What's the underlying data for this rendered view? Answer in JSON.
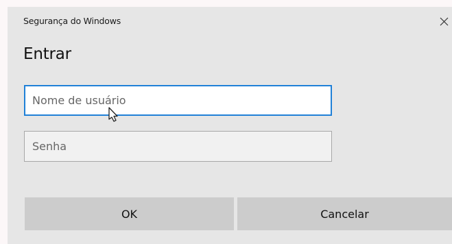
{
  "dialog": {
    "window_title": "Segurança do Windows",
    "heading": "Entrar",
    "close_glyph": "✕",
    "username": {
      "value": "",
      "placeholder": "Nome de usuário"
    },
    "password": {
      "value": "",
      "placeholder": "Senha"
    },
    "buttons": {
      "ok_label": "OK",
      "cancel_label": "Cancelar"
    }
  },
  "colors": {
    "dialog_background": "#e6e6e6",
    "focus_border": "#1f80d7",
    "button_background": "#cccccc"
  },
  "icons": {
    "close": "close-icon",
    "pointer": "mouse-pointer-icon"
  }
}
